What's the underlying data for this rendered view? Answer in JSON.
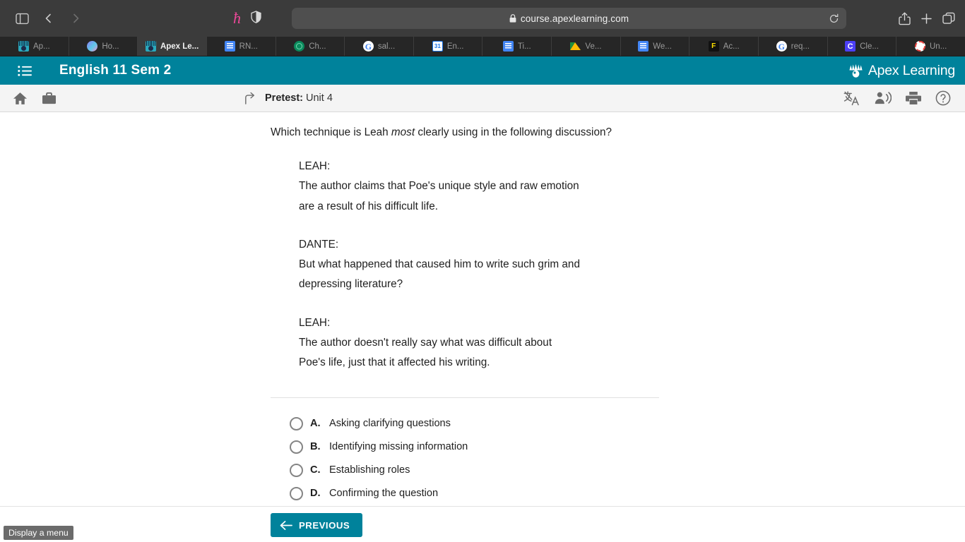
{
  "browser": {
    "sidebar_toggle_icon": "sidebar-icon",
    "back_icon": "chevron-left-icon",
    "forward_icon": "chevron-right-icon",
    "honey_icon": "honey-extension-icon",
    "shield_icon": "shield-extension-icon",
    "lock_icon": "lock-icon",
    "url": "course.apexlearning.com",
    "reload_icon": "reload-icon",
    "share_icon": "share-icon",
    "new_tab_icon": "plus-icon",
    "tab_overview_icon": "tab-overview-icon",
    "tabs": [
      {
        "label": "Ap...",
        "favicon": "apex-favicon",
        "favclass": "fav-apex",
        "glyph": "",
        "active": false
      },
      {
        "label": "Ho...",
        "favicon": "hex-favicon",
        "favclass": "fav-hex",
        "glyph": "",
        "active": false
      },
      {
        "label": "Apex Le...",
        "favicon": "apex-favicon",
        "favclass": "fav-apex",
        "glyph": "",
        "active": true
      },
      {
        "label": "RN...",
        "favicon": "google-docs-favicon",
        "favclass": "fav-docs",
        "glyph": "",
        "active": false
      },
      {
        "label": "Ch...",
        "favicon": "green-circle-favicon",
        "favclass": "fav-green",
        "glyph": "",
        "active": false
      },
      {
        "label": "sal...",
        "favicon": "google-favicon",
        "favclass": "fav-google",
        "glyph": "G",
        "active": false
      },
      {
        "label": "En...",
        "favicon": "google-calendar-favicon",
        "favclass": "fav-cal",
        "glyph": "31",
        "active": false
      },
      {
        "label": "Ti...",
        "favicon": "google-docs-favicon",
        "favclass": "fav-docs",
        "glyph": "",
        "active": false
      },
      {
        "label": "Ve...",
        "favicon": "google-drive-favicon",
        "favclass": "fav-drive",
        "glyph": "",
        "active": false
      },
      {
        "label": "We...",
        "favicon": "google-docs-favicon",
        "favclass": "fav-docs",
        "glyph": "",
        "active": false
      },
      {
        "label": "Ac...",
        "favicon": "f-favicon",
        "favclass": "fav-f",
        "glyph": "F",
        "active": false
      },
      {
        "label": "req...",
        "favicon": "google-favicon",
        "favclass": "fav-google",
        "glyph": "G",
        "active": false
      },
      {
        "label": "Cle...",
        "favicon": "clever-favicon",
        "favclass": "fav-c",
        "glyph": "C",
        "active": false
      },
      {
        "label": "Un...",
        "favicon": "red-ring-favicon",
        "favclass": "fav-red",
        "glyph": "",
        "active": false
      }
    ]
  },
  "app_header": {
    "menu_icon": "list-menu-icon",
    "course_title": "English 11 Sem 2",
    "brand_name": "Apex Learning",
    "brand_icon": "apex-learning-logo-icon",
    "background_color": "#00829b"
  },
  "toolbar": {
    "home_icon": "home-icon",
    "briefcase_icon": "briefcase-icon",
    "up_arrow_icon": "return-up-arrow-icon",
    "activity_label": "Pretest:",
    "activity_value": "Unit 4",
    "translate_icon": "translate-icon",
    "read_aloud_icon": "read-aloud-icon",
    "print_icon": "print-icon",
    "help_icon": "help-circle-icon"
  },
  "question": {
    "stem_before": "Which technique is Leah ",
    "stem_emphasis": "most",
    "stem_after": " clearly using in the following discussion?",
    "dialogue": [
      {
        "speaker": "LEAH:",
        "line1": "The author claims that Poe's unique style and raw emotion",
        "line2": "are a result of his difficult life."
      },
      {
        "speaker": "DANTE:",
        "line1": "But what happened that caused him to write such grim and",
        "line2": "depressing literature?"
      },
      {
        "speaker": "LEAH:",
        "line1": "The author doesn't really say what was difficult about",
        "line2": "Poe's life, just that it affected his writing."
      }
    ],
    "options": [
      {
        "letter": "A.",
        "text": "Asking clarifying questions",
        "selected": false
      },
      {
        "letter": "B.",
        "text": "Identifying missing information",
        "selected": false
      },
      {
        "letter": "C.",
        "text": "Establishing roles",
        "selected": false
      },
      {
        "letter": "D.",
        "text": "Confirming the question",
        "selected": false
      }
    ]
  },
  "footer": {
    "previous_label": "PREVIOUS",
    "previous_icon": "arrow-left-icon"
  },
  "tooltip": {
    "text": "Display a menu"
  }
}
